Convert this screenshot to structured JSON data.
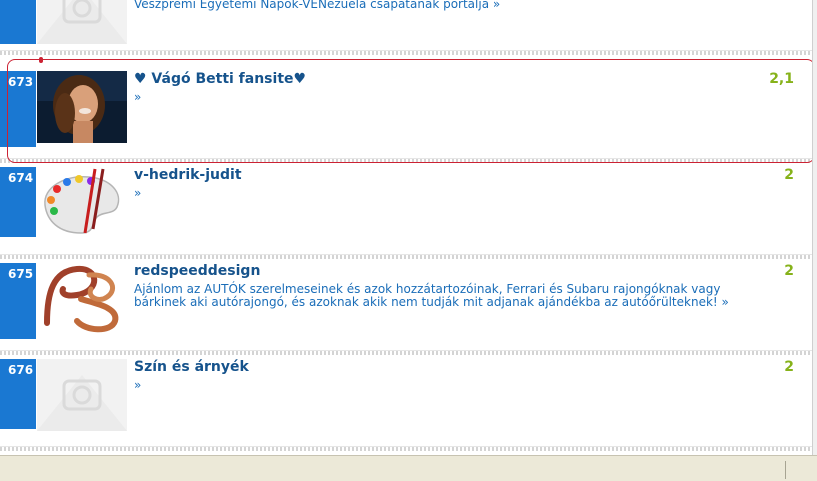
{
  "top_partial": {
    "desc": "Veszprémi Egyetemi Napok-VENezuela csapatának portálja »"
  },
  "items": [
    {
      "rank": "673",
      "title": "♥ Vágó Betti fansite♥",
      "desc": "»",
      "score": "2,1"
    },
    {
      "rank": "674",
      "title": "v-hedrik-judit",
      "desc": "»",
      "score": "2"
    },
    {
      "rank": "675",
      "title": "redspeeddesign",
      "desc": "Ajánlom az AUTÓK szerelmeseinek és azok hozzátartozóinak, Ferrari és Subaru rajongóknak vagy bárkinek aki autórajongó, és azoknak akik nem tudják mit adjanak ajándékba az autóőrülteknek! »",
      "score": "2"
    },
    {
      "rank": "676",
      "title": "Szín és árnyék",
      "desc": "»",
      "score": "2"
    }
  ],
  "colors": {
    "rank_bg": "#1a78d2",
    "title": "#16538c",
    "score": "#86b21a",
    "highlight_border": "#cc2233"
  }
}
